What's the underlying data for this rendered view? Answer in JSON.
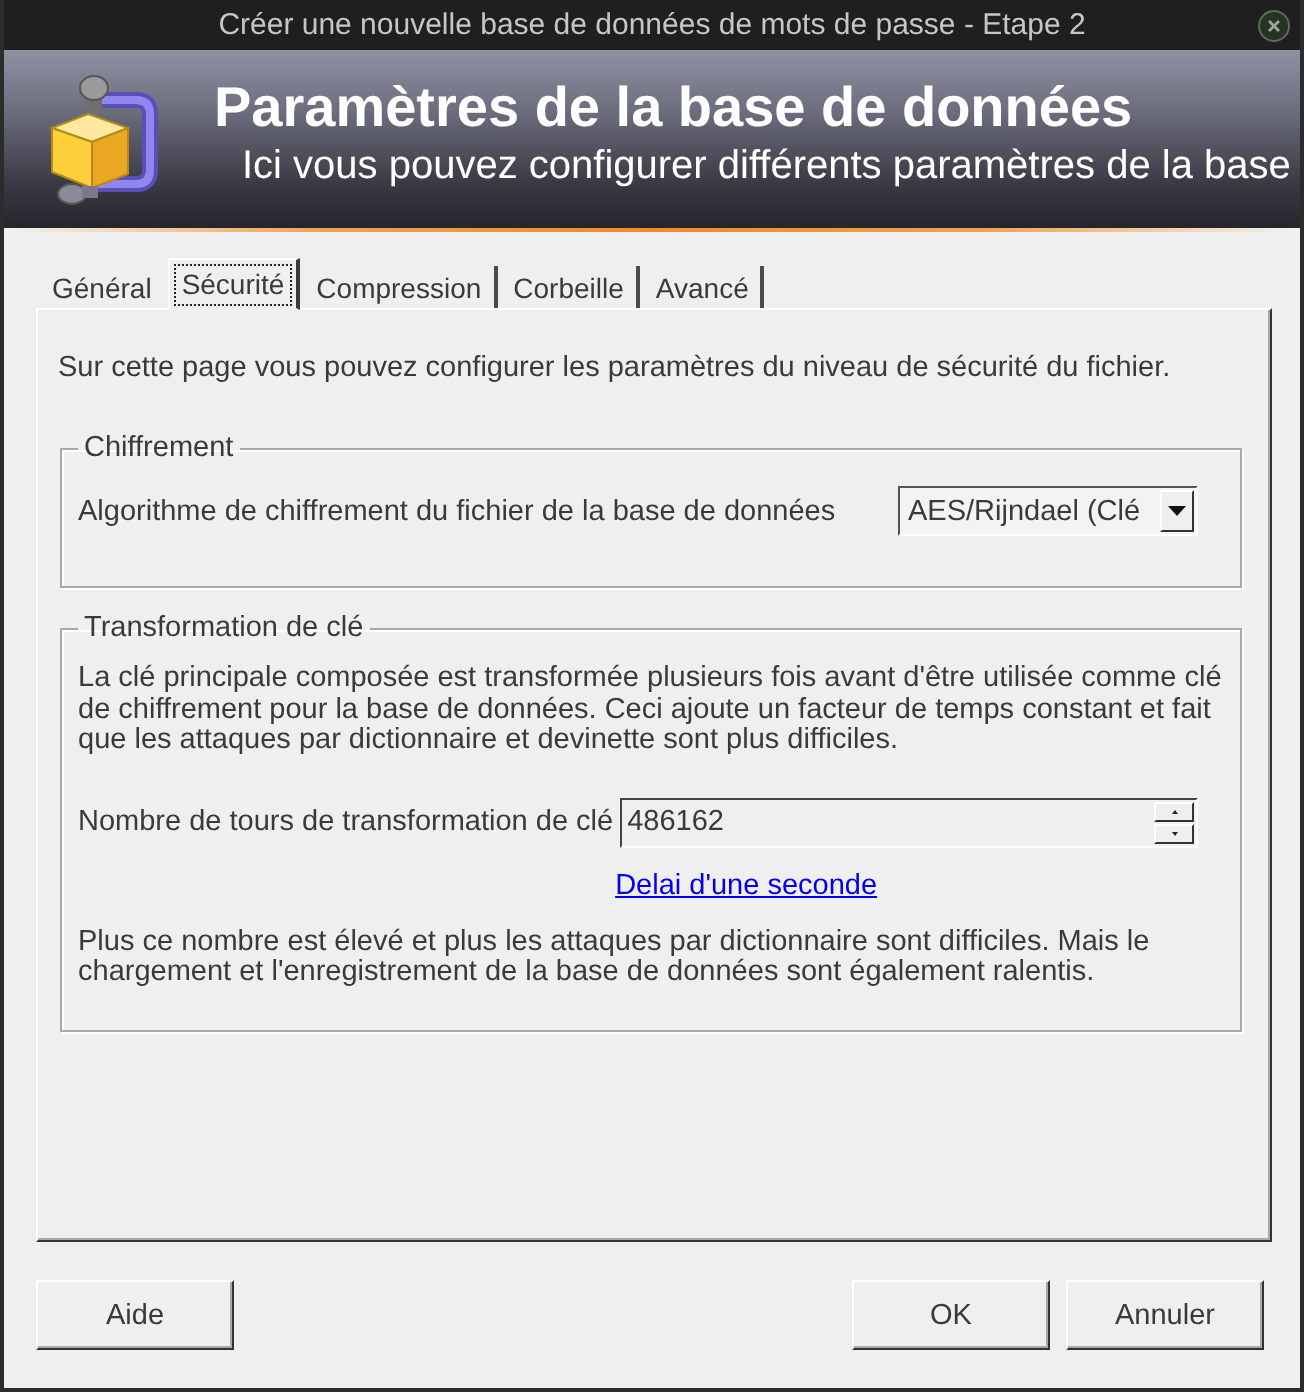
{
  "window": {
    "title": "Créer une nouvelle base de données de mots de passe - Etape 2"
  },
  "header": {
    "title": "Paramètres de la base de données",
    "subtitle": "Ici vous pouvez configurer différents paramètres de la base"
  },
  "tabs": [
    {
      "label": "Général",
      "selected": false
    },
    {
      "label": "Sécurité",
      "selected": true
    },
    {
      "label": "Compression",
      "selected": false
    },
    {
      "label": "Corbeille",
      "selected": false
    },
    {
      "label": "Avancé",
      "selected": false
    }
  ],
  "page": {
    "intro": "Sur cette page vous pouvez configurer les paramètres du niveau de sécurité du fichier.",
    "groups": [
      {
        "kind": "select",
        "title": "Chiffrement",
        "label": "Algorithme de chiffrement du fichier de la base de données",
        "value": "AES/Rijndael (Clé"
      },
      {
        "kind": "spin",
        "title": "Transformation de clé",
        "description": "La clé principale composée est transformée plusieurs fois avant d'être utilisée comme clé de chiffrement pour la base de données. Ceci ajoute un facteur de temps constant et fait que les attaques par dictionnaire et devinette sont plus difficiles.",
        "label": "Nombre de tours de transformation de clé",
        "value": "486162",
        "link": "Delai d'une seconde",
        "note": "Plus ce nombre est élevé et plus les attaques par dictionnaire sont difficiles. Mais le chargement et l'enregistrement de la base de données sont également ralentis."
      }
    ]
  },
  "buttons_left": [
    {
      "label": "Aide"
    }
  ],
  "buttons_right": [
    {
      "label": "OK"
    },
    {
      "label": "Annuler"
    }
  ]
}
